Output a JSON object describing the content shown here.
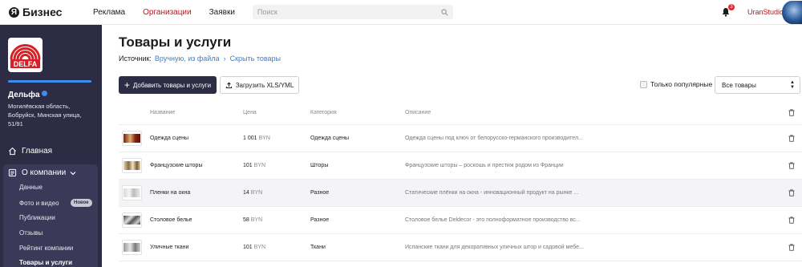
{
  "topbar": {
    "logo_letter": "Я",
    "logo_text": "Бизнес",
    "nav": [
      {
        "label": "Реклама",
        "active": false
      },
      {
        "label": "Организации",
        "active": true
      },
      {
        "label": "Заявки",
        "active": false
      }
    ],
    "search_placeholder": "Поиск",
    "notifications_count": "3",
    "username": "UranStudio"
  },
  "sidebar": {
    "brand_logo_text": "DELFA",
    "profile_progress_percent": 100,
    "company_name": "Дельфа",
    "company_address": "Могилёвская область, Бобруйск, Минская улица, 51/91",
    "home_label": "Главная",
    "about_label": "О компании",
    "sub_items": [
      {
        "label": "Данные"
      },
      {
        "label": "Фото и видео"
      },
      {
        "label": "Публикации"
      },
      {
        "label": "Отзывы"
      },
      {
        "label": "Рейтинг компании"
      },
      {
        "label": "Товары и услуги"
      }
    ],
    "new_badge": "Новое"
  },
  "main": {
    "title": "Товары и услуги",
    "source_label": "Источник:",
    "source_value": "Вручную, из файла",
    "hide_link": "Скрыть товары",
    "add_button": "Добавить товары и услуги",
    "upload_button": "Загрузить XLS/YML",
    "popular_label": "Только популярные",
    "filter_selected": "Все товары",
    "columns": {
      "name": "Название",
      "price": "Цена",
      "category": "Категория",
      "description": "Описание"
    },
    "rows": [
      {
        "name": "Одежда сцены",
        "price": "1 001",
        "currency": "BYN",
        "category": "Одежда сцены",
        "description": "Одежда сцены под ключ от белорусско-германского производител..."
      },
      {
        "name": "Французские шторы",
        "price": "101",
        "currency": "BYN",
        "category": "Шторы",
        "description": "Французские шторы – роскошь и престиж родом из Франции"
      },
      {
        "name": "Пленки на окна",
        "price": "14",
        "currency": "BYN",
        "category": "Разное",
        "description": "Статические плёнки на окна - инновационный продукт на рынке ..."
      },
      {
        "name": "Столовое белье",
        "price": "58",
        "currency": "BYN",
        "category": "Разное",
        "description": "Столовое белье Deldecor - это полноформатное производство вс..."
      },
      {
        "name": "Уличные ткани",
        "price": "101",
        "currency": "BYN",
        "category": "Ткани",
        "description": "Испанские ткани для декоративных уличных штор и садовой мебе..."
      }
    ]
  },
  "colors": {
    "sidebar_bg": "#2c2c45",
    "accent_red": "#c4121c",
    "link_blue": "#3a7fd5"
  }
}
